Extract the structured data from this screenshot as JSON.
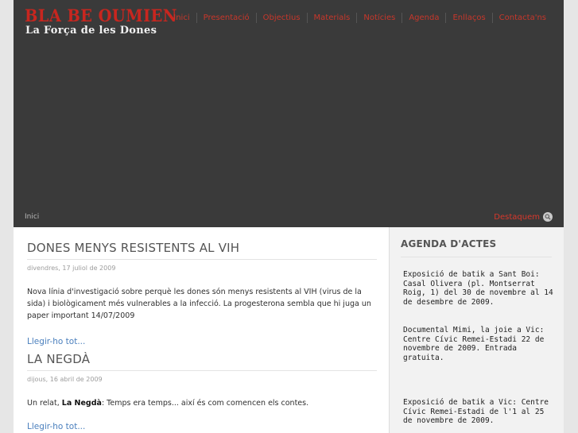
{
  "site": {
    "title": "BLA BE OUMIEN",
    "subtitle": "La Força de les Dones"
  },
  "nav": [
    "Inici",
    "Presentació",
    "Objectius",
    "Materials",
    "Notícies",
    "Agenda",
    "Enllaços",
    "Contacta'ns"
  ],
  "header": {
    "breadcrumb": "Inici",
    "featured_label": "Destaquem"
  },
  "posts": [
    {
      "title": "DONES MENYS RESISTENTS AL VIH",
      "date": "divendres, 17 juliol de 2009",
      "body": "Nova línia d'investigació sobre perquè les dones són menys resistents al VIH (virus de la sida) i biològicament més vulnerables a la infecció. La progesterona sembla que hi juga un paper important 14/07/2009",
      "more": "Llegir-ho tot..."
    },
    {
      "title": "LA NEGDÀ",
      "date": "dijous, 16 abril de 2009",
      "body_prefix": "Un relat, ",
      "body_bold": "La Negdà",
      "body_suffix": ": Temps era temps... així és com comencen els contes.",
      "more": "Llegir-ho tot..."
    }
  ],
  "sidebar": {
    "heading": "AGENDA D'ACTES",
    "events": [
      "Exposició de batik a Sant Boi: Casal Olivera (pl. Montserrat Roig, 1) del 30 de novembre al 14 de desembre de 2009.",
      "Documental Mimi, la joie a Vic: Centre  Cívic Remei-Estadi 22 de novembre de 2009. Entrada gratuita.",
      "Exposició de batik a Vic: Centre Cívic Remei-Estadi de l'1 al 25 de novembre de 2009."
    ]
  },
  "colors": {
    "page_bg": "#e6e6e6",
    "header_bg": "#3a3a3a",
    "accent_red": "#c7372b",
    "link_blue": "#4a7fbd",
    "sidebar_bg": "#f2f2f2"
  }
}
